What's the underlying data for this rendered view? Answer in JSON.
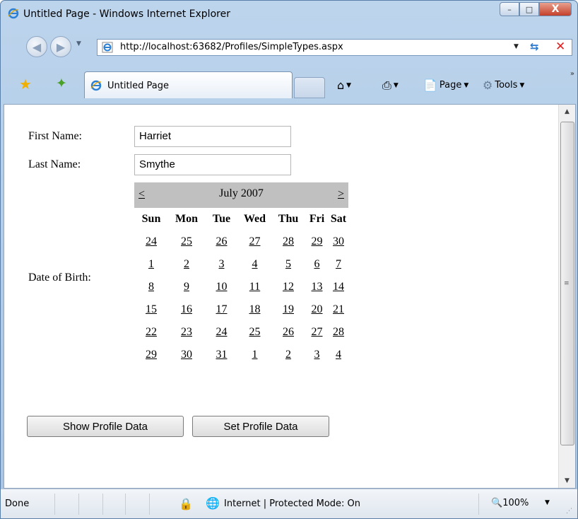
{
  "window": {
    "title": "Untitled Page - Windows Internet Explorer",
    "minimize_glyph": "–",
    "maximize_glyph": "□",
    "close_glyph": "X"
  },
  "address": {
    "url": "http://localhost:63682/Profiles/SimpleTypes.aspx"
  },
  "tabs": {
    "active_label": "Untitled Page"
  },
  "commandbar": {
    "page_label": "Page",
    "tools_label": "Tools"
  },
  "form": {
    "first_name_label": "First Name:",
    "first_name_value": "Harriet",
    "last_name_label": "Last Name:",
    "last_name_value": "Smythe",
    "dob_label": "Date of Birth:",
    "show_button": "Show Profile Data",
    "set_button": "Set Profile Data"
  },
  "calendar": {
    "prev": "<",
    "next": ">",
    "title": "July 2007",
    "days_of_week": [
      "Sun",
      "Mon",
      "Tue",
      "Wed",
      "Thu",
      "Fri",
      "Sat"
    ],
    "weeks": [
      [
        "24",
        "25",
        "26",
        "27",
        "28",
        "29",
        "30"
      ],
      [
        "1",
        "2",
        "3",
        "4",
        "5",
        "6",
        "7"
      ],
      [
        "8",
        "9",
        "10",
        "11",
        "12",
        "13",
        "14"
      ],
      [
        "15",
        "16",
        "17",
        "18",
        "19",
        "20",
        "21"
      ],
      [
        "22",
        "23",
        "24",
        "25",
        "26",
        "27",
        "28"
      ],
      [
        "29",
        "30",
        "31",
        "1",
        "2",
        "3",
        "4"
      ]
    ]
  },
  "status": {
    "text": "Done",
    "zone": "Internet | Protected Mode: On",
    "zoom": "100%"
  },
  "colors": {
    "calendar_header": "#c0c0c0",
    "close_button": "#c4402a"
  }
}
